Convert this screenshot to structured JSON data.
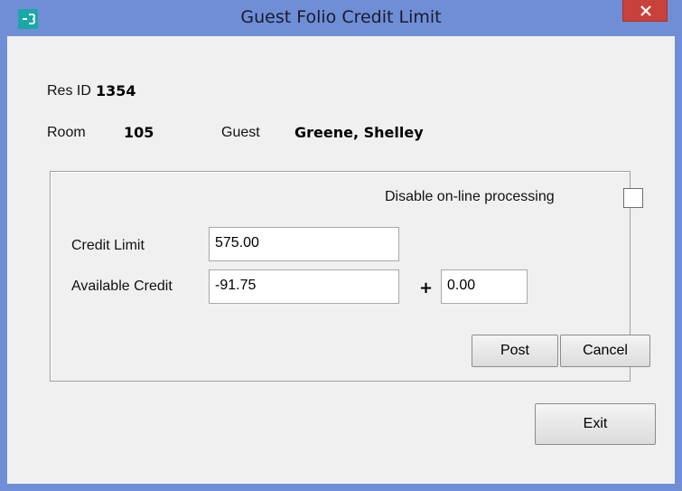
{
  "window": {
    "title": "Guest Folio Credit Limit"
  },
  "reservation": {
    "res_id_label": "Res ID",
    "res_id": "1354",
    "room_label": "Room",
    "room": "105",
    "guest_label": "Guest",
    "guest": "Greene, Shelley"
  },
  "processing": {
    "disable_online_label": "Disable on-line processing",
    "disable_online_checked": false
  },
  "credit": {
    "limit_label": "Credit Limit",
    "limit_value": "575.00",
    "available_label": "Available Credit",
    "available_value": "-91.75",
    "plus_sign": "+",
    "additional_value": "0.00"
  },
  "buttons": {
    "post": "Post",
    "cancel": "Cancel",
    "exit": "Exit"
  },
  "colors": {
    "titlebar": "#6f8ed6",
    "close": "#c7423a",
    "client": "#f0f0f0"
  }
}
